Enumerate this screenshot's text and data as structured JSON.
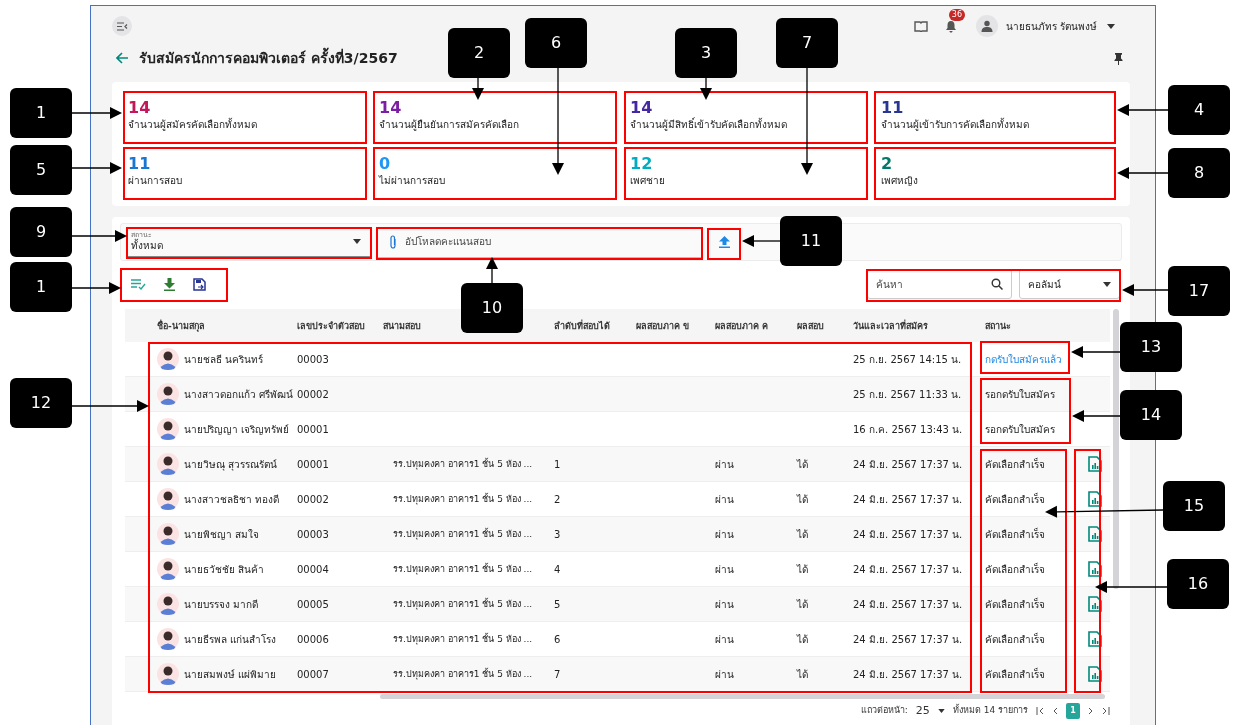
{
  "header": {
    "notification_count": "36",
    "user_name": "นายธนภัทร รัตนพงษ์"
  },
  "title": "รับสมัครนักการคอมพิวเตอร์ ครั้งที่3/2567",
  "stats": [
    {
      "value": "14",
      "label": "จำนวนผู้สมัครคัดเลือกทั้งหมด",
      "color": "#c2185b"
    },
    {
      "value": "14",
      "label": "จำนวนผู้ยืนยันการสมัครคัดเลือก",
      "color": "#7b1fa2"
    },
    {
      "value": "14",
      "label": "จำนวนผู้มีสิทธิ์เข้ารับคัดเลือกทั้งหมด",
      "color": "#4527a0"
    },
    {
      "value": "11",
      "label": "จำนวนผู้เข้ารับการคัดเลือกทั้งหมด",
      "color": "#283593"
    },
    {
      "value": "11",
      "label": "ผ่านการสอบ",
      "color": "#1976d2"
    },
    {
      "value": "0",
      "label": "ไม่ผ่านการสอบ",
      "color": "#2196f3"
    },
    {
      "value": "12",
      "label": "เพศชาย",
      "color": "#00acc1"
    },
    {
      "value": "2",
      "label": "เพศหญิง",
      "color": "#00796b"
    }
  ],
  "filters": {
    "status_label": "สถานะ",
    "status_value": "ทั้งหมด",
    "upload_placeholder": "อัปโหลดคะแนนสอบ",
    "search_placeholder": "ค้นหา",
    "columns_select": "คอลัมน์"
  },
  "table": {
    "columns": [
      "ชื่อ-นามสกุล",
      "เลขประจำตัวสอบ",
      "สนามสอบ",
      "ลำดับที่สอบได้",
      "ผลสอบภาค ข",
      "ผลสอบภาค ค",
      "ผลสอบ",
      "วันและเวลาที่สมัคร",
      "สถานะ"
    ],
    "rows": [
      {
        "name": "นายชลธี นครินทร์",
        "exam_no": "00003",
        "venue": "",
        "rank": "",
        "part_b": "",
        "part_c": "",
        "result": "",
        "applied_at": "25 ก.ย. 2567 14:15 น.",
        "status": "กดรับใบสมัครแล้ว",
        "status_link": true,
        "report": false
      },
      {
        "name": "นางสาวดอกแก้ว ศรีพัฒน์",
        "exam_no": "00002",
        "venue": "",
        "rank": "",
        "part_b": "",
        "part_c": "",
        "result": "",
        "applied_at": "25 ก.ย. 2567 11:33 น.",
        "status": "รอกดรับใบสมัคร",
        "status_link": false,
        "report": false
      },
      {
        "name": "นายปริญญา เจริญทรัพย์",
        "exam_no": "00001",
        "venue": "",
        "rank": "",
        "part_b": "",
        "part_c": "",
        "result": "",
        "applied_at": "16 ก.ค. 2567 13:43 น.",
        "status": "รอกดรับใบสมัคร",
        "status_link": false,
        "report": false
      },
      {
        "name": "นายวิษณุ สุวรรณรัตน์",
        "exam_no": "00001",
        "venue": "รร.ปทุมคงคา อาคาร1 ชั้น 5 ห้อง ...",
        "rank": "1",
        "part_b": "",
        "part_c": "ผ่าน",
        "result": "ได้",
        "applied_at": "24 มิ.ย. 2567 17:37 น.",
        "status": "คัดเลือกสำเร็จ",
        "status_link": false,
        "report": true
      },
      {
        "name": "นางสาวชลธิชา ทองดี",
        "exam_no": "00002",
        "venue": "รร.ปทุมคงคา อาคาร1 ชั้น 5 ห้อง ...",
        "rank": "2",
        "part_b": "",
        "part_c": "ผ่าน",
        "result": "ได้",
        "applied_at": "24 มิ.ย. 2567 17:37 น.",
        "status": "คัดเลือกสำเร็จ",
        "status_link": false,
        "report": true
      },
      {
        "name": "นายพิชญา สมใจ",
        "exam_no": "00003",
        "venue": "รร.ปทุมคงคา อาคาร1 ชั้น 5 ห้อง ...",
        "rank": "3",
        "part_b": "",
        "part_c": "ผ่าน",
        "result": "ได้",
        "applied_at": "24 มิ.ย. 2567 17:37 น.",
        "status": "คัดเลือกสำเร็จ",
        "status_link": false,
        "report": true
      },
      {
        "name": "นายธวัชชัย สินค้า",
        "exam_no": "00004",
        "venue": "รร.ปทุมคงคา อาคาร1 ชั้น 5 ห้อง ...",
        "rank": "4",
        "part_b": "",
        "part_c": "ผ่าน",
        "result": "ได้",
        "applied_at": "24 มิ.ย. 2567 17:37 น.",
        "status": "คัดเลือกสำเร็จ",
        "status_link": false,
        "report": true
      },
      {
        "name": "นายบรรจง มากดี",
        "exam_no": "00005",
        "venue": "รร.ปทุมคงคา อาคาร1 ชั้น 5 ห้อง ...",
        "rank": "5",
        "part_b": "",
        "part_c": "ผ่าน",
        "result": "ได้",
        "applied_at": "24 มิ.ย. 2567 17:37 น.",
        "status": "คัดเลือกสำเร็จ",
        "status_link": false,
        "report": true
      },
      {
        "name": "นายธีรพล แก่นสำโรง",
        "exam_no": "00006",
        "venue": "รร.ปทุมคงคา อาคาร1 ชั้น 5 ห้อง ...",
        "rank": "6",
        "part_b": "",
        "part_c": "ผ่าน",
        "result": "ได้",
        "applied_at": "24 มิ.ย. 2567 17:37 น.",
        "status": "คัดเลือกสำเร็จ",
        "status_link": false,
        "report": true
      },
      {
        "name": "นายสมพงษ์ แผ่พิมาย",
        "exam_no": "00007",
        "venue": "รร.ปทุมคงคา อาคาร1 ชั้น 5 ห้อง ...",
        "rank": "7",
        "part_b": "",
        "part_c": "ผ่าน",
        "result": "ได้",
        "applied_at": "24 มิ.ย. 2567 17:37 น.",
        "status": "คัดเลือกสำเร็จ",
        "status_link": false,
        "report": true
      }
    ]
  },
  "pagination": {
    "rows_per_page_label": "แถวต่อหน้า:",
    "rows_per_page": "25",
    "total": "ทั้งหมด 14 รายการ",
    "page": "1"
  },
  "callouts": [
    "1",
    "2",
    "6",
    "3",
    "7",
    "4",
    "5",
    "8",
    "9",
    "1",
    "10",
    "11",
    "17",
    "13",
    "12",
    "14",
    "15",
    "16"
  ]
}
